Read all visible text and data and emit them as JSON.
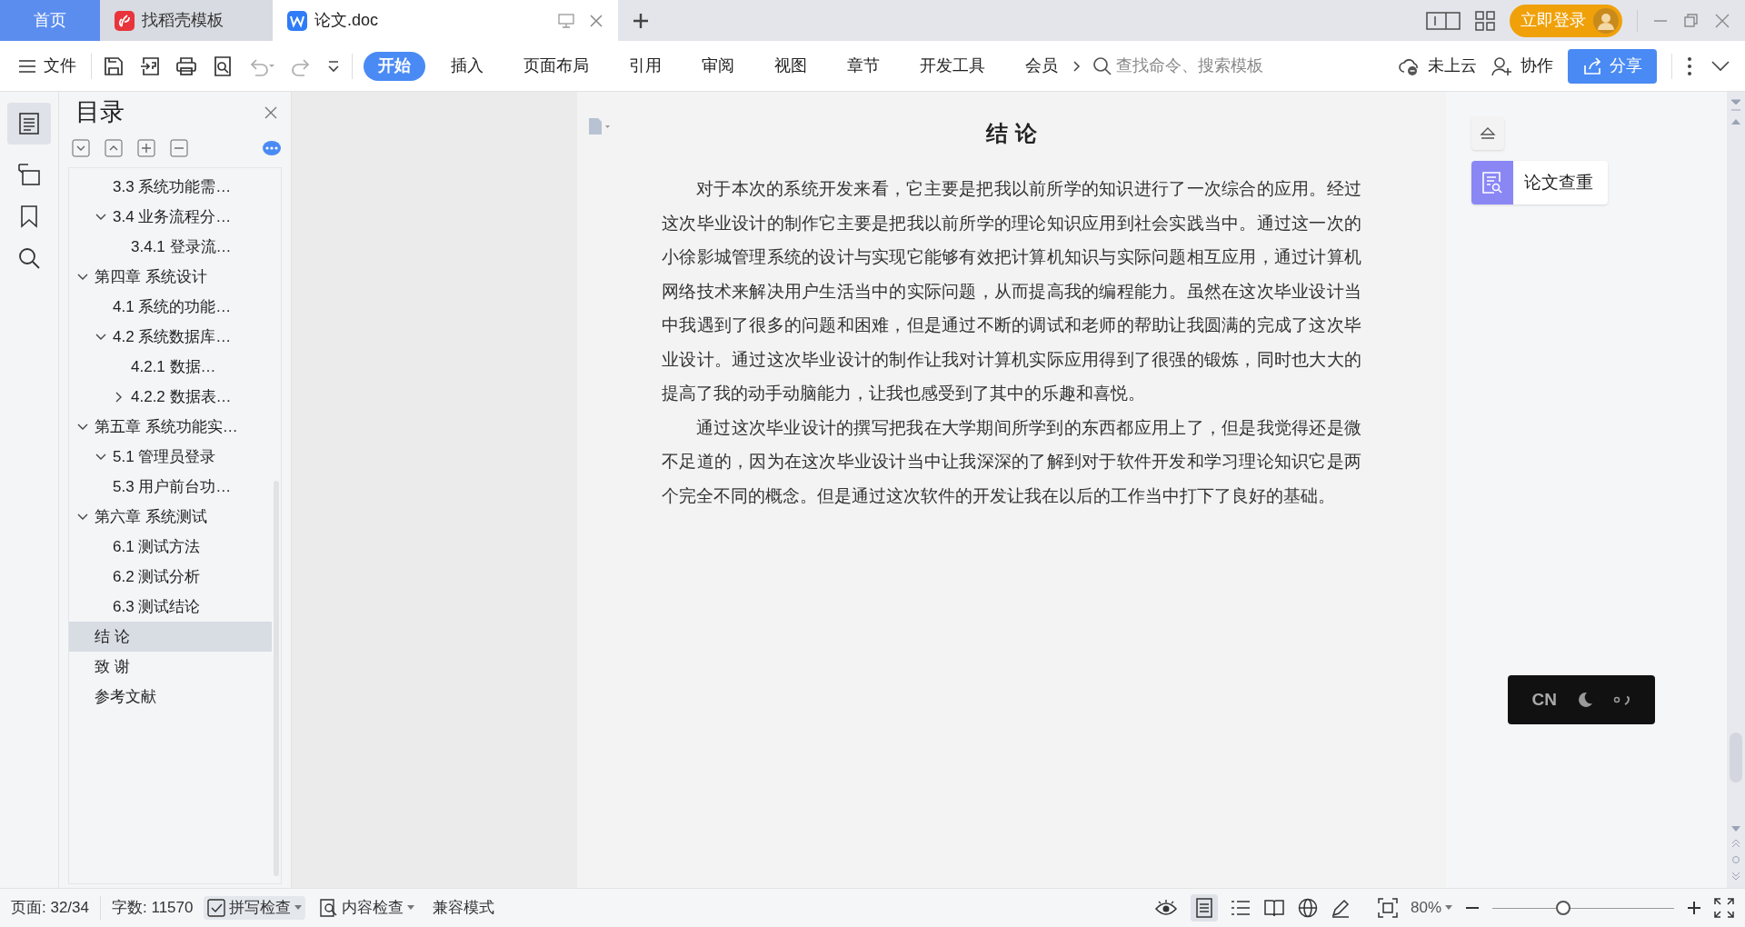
{
  "tabs": [
    {
      "label": "首页",
      "kind": "home",
      "selected": false
    },
    {
      "label": "找稻壳模板",
      "kind": "template",
      "selected": false
    },
    {
      "label": "论文.doc",
      "kind": "doc",
      "selected": true
    }
  ],
  "account": {
    "login": "立即登录"
  },
  "toolbar": {
    "file_menu": "文件",
    "ribbon_tabs": [
      {
        "label": "开始",
        "selected": true
      },
      {
        "label": "插入",
        "selected": false
      },
      {
        "label": "页面布局",
        "selected": false
      },
      {
        "label": "引用",
        "selected": false
      },
      {
        "label": "审阅",
        "selected": false
      },
      {
        "label": "视图",
        "selected": false
      },
      {
        "label": "章节",
        "selected": false
      },
      {
        "label": "开发工具",
        "selected": false
      },
      {
        "label": "会员",
        "selected": false
      }
    ],
    "search": {
      "placeholder": "查找命令、搜索模板"
    },
    "cloud": "未上云",
    "collab": "协作",
    "share": "分享"
  },
  "sidebar": {
    "title": "目录",
    "items": [
      {
        "children": [
          {
            "label": "3.3 系统功能需…",
            "selected": false
          },
          {
            "label": "3.4 业务流程分…",
            "selected": false,
            "expanded": true,
            "children": [
              {
                "label": "3.4.1 登录流…",
                "selected": false
              }
            ]
          }
        ]
      },
      {
        "label": "第四章 系统设计",
        "selected": false,
        "expanded": true,
        "children": [
          {
            "label": "4.1 系统的功能…",
            "selected": false
          },
          {
            "label": "4.2 系统数据库…",
            "selected": false,
            "expanded": true,
            "children": [
              {
                "label": "4.2.1 数据…",
                "selected": false
              },
              {
                "label": "4.2.2 数据表…",
                "selected": false,
                "expanded": false
              }
            ]
          }
        ]
      },
      {
        "label": "第五章 系统功能实…",
        "selected": false,
        "expanded": true,
        "children": [
          {
            "label": "5.1 管理员登录",
            "selected": false,
            "expanded": true
          },
          {
            "label": "5.3 用户前台功…",
            "selected": false
          }
        ]
      },
      {
        "label": "第六章 系统测试",
        "selected": false,
        "expanded": true,
        "children": [
          {
            "label": "6.1 测试方法",
            "selected": false
          },
          {
            "label": "6.2 测试分析",
            "selected": false
          },
          {
            "label": "6.3 测试结论",
            "selected": false
          }
        ]
      },
      {
        "label": "结 论",
        "selected": true
      },
      {
        "label": "致 谢",
        "selected": false
      },
      {
        "label": "参考文献",
        "selected": false
      }
    ]
  },
  "document": {
    "title": "结 论",
    "paragraphs": [
      "对于本次的系统开发来看，它主要是把我以前所学的知识进行了一次综合的应用。经过这次毕业设计的制作它主要是把我以前所学的理论知识应用到社会实践当中。通过这一次的小徐影城管理系统的设计与实现它能够有效把计算机知识与实际问题相互应用，通过计算机网络技术来解决用户生活当中的实际问题，从而提高我的编程能力。虽然在这次毕业设计当中我遇到了很多的问题和困难，但是通过不断的调试和老师的帮助让我圆满的完成了这次毕业设计。通过这次毕业设计的制作让我对计算机实际应用得到了很强的锻炼，同时也大大的提高了我的动手动脑能力，让我也感受到了其中的乐趣和喜悦。",
      "通过这次毕业设计的撰写把我在大学期间所学到的东西都应用上了，但是我觉得还是微不足道的，因为在这次毕业设计当中让我深深的了解到对于软件开发和学习理论知识它是两个完全不同的概念。但是通过这次软件的开发让我在以后的工作当中打下了良好的基础。"
    ]
  },
  "side_panel": {
    "check_button": "论文查重"
  },
  "ime": {
    "mode": "CN"
  },
  "status_bar": {
    "page": "页面: 32/34",
    "words": "字数: 11570",
    "spell_check": "拼写检查",
    "content_check": "内容检查",
    "compat": "兼容模式",
    "zoom": "80%",
    "zoom_slider": {
      "level": 0.39
    }
  }
}
